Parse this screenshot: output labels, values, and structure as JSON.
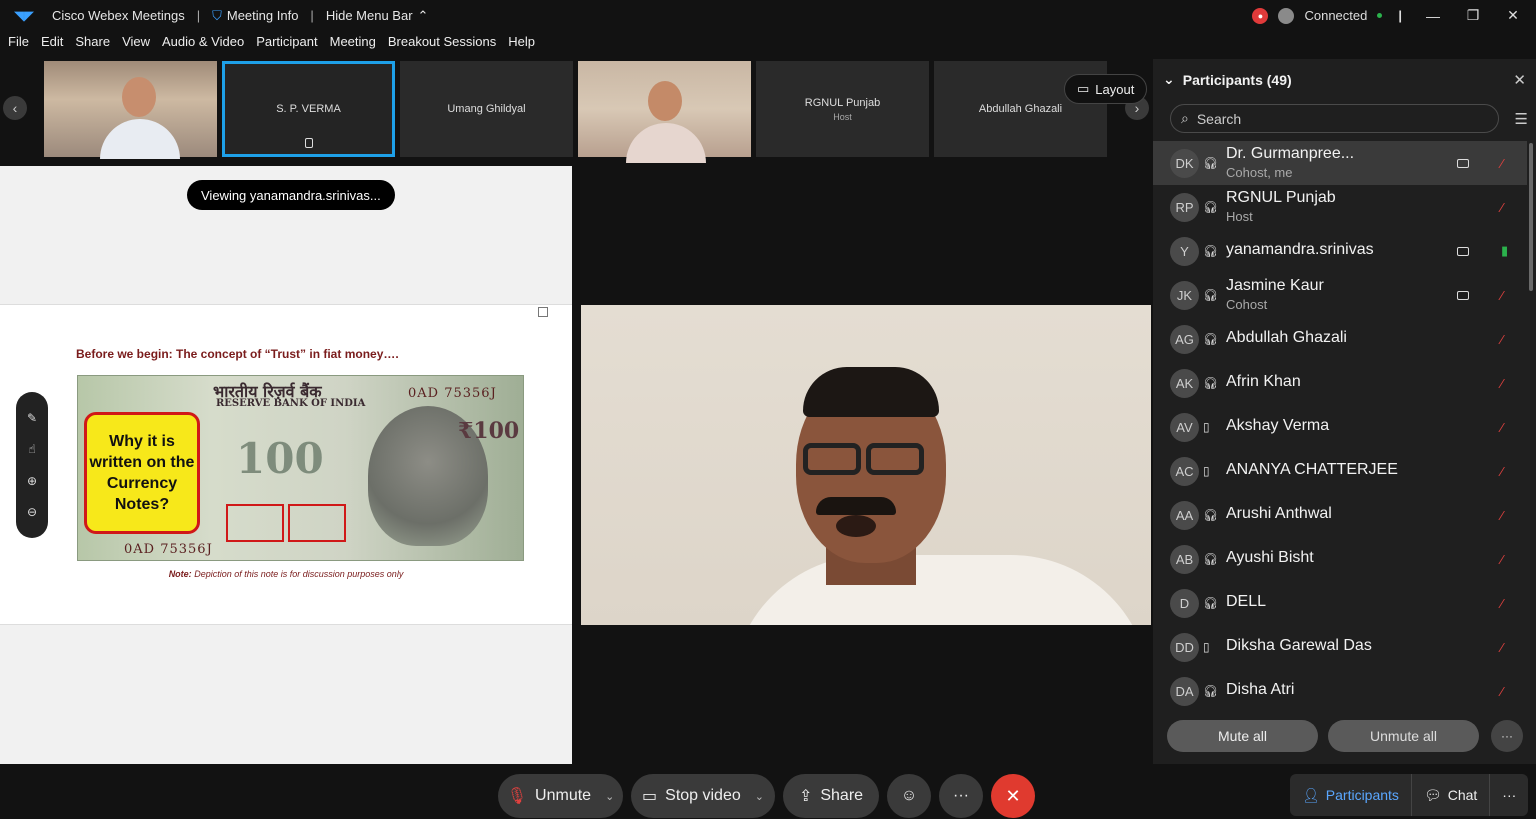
{
  "titlebar": {
    "app_name": "Cisco Webex Meetings",
    "meeting_info": "Meeting Info",
    "hide_menu": "Hide Menu Bar",
    "connection": "Connected"
  },
  "menu": [
    "File",
    "Edit",
    "Share",
    "View",
    "Audio & Video",
    "Participant",
    "Meeting",
    "Breakout Sessions",
    "Help"
  ],
  "filmstrip": {
    "tiles": [
      {
        "name": "",
        "type": "video"
      },
      {
        "name": "S. P. VERMA",
        "sub": ""
      },
      {
        "name": "Umang Ghildyal",
        "sub": ""
      },
      {
        "name": "",
        "type": "video"
      },
      {
        "name": "RGNUL Punjab",
        "sub": "Host"
      },
      {
        "name": "Abdullah Ghazali",
        "sub": ""
      }
    ],
    "layout_label": "Layout"
  },
  "share": {
    "viewing_label": "Viewing yanamandra.srinivas...",
    "slide_title": "Before we begin: The concept of “Trust” in fiat money….",
    "callout": "Why it is written on the Currency Notes?",
    "note_caption_bold": "Note:",
    "note_caption": "Depiction of this note is for discussion purposes only",
    "banknote": {
      "top_text": "भारतीय रिज़र्व बैंक",
      "bank": "RESERVE BANK OF INDIA",
      "serial": "0AD 75356J",
      "denomination": "₹100",
      "big": "100"
    }
  },
  "panel": {
    "title": "Participants (49)",
    "search_placeholder": "Search",
    "participants": [
      {
        "initials": "DK",
        "name": "Dr. Gurmanpree...",
        "role": "Cohost, me",
        "device": "headset",
        "video": true,
        "mic": "muted"
      },
      {
        "initials": "RP",
        "name": "RGNUL Punjab",
        "role": "Host",
        "device": "headset",
        "video": false,
        "mic": "muted"
      },
      {
        "initials": "Y",
        "name": "yanamandra.srinivas",
        "role": "",
        "device": "headset",
        "video": true,
        "mic": "on"
      },
      {
        "initials": "JK",
        "name": "Jasmine Kaur",
        "role": "Cohost",
        "device": "headset",
        "video": true,
        "mic": "muted"
      },
      {
        "initials": "AG",
        "name": "Abdullah Ghazali",
        "role": "",
        "device": "headset",
        "video": false,
        "mic": "muted"
      },
      {
        "initials": "AK",
        "name": "Afrin Khan",
        "role": "",
        "device": "headset",
        "video": false,
        "mic": "muted"
      },
      {
        "initials": "AV",
        "name": "Akshay Verma",
        "role": "",
        "device": "phone",
        "video": false,
        "mic": "muted"
      },
      {
        "initials": "AC",
        "name": "ANANYA CHATTERJEE",
        "role": "",
        "device": "phone",
        "video": false,
        "mic": "muted"
      },
      {
        "initials": "AA",
        "name": "Arushi Anthwal",
        "role": "",
        "device": "headset",
        "video": false,
        "mic": "muted"
      },
      {
        "initials": "AB",
        "name": "Ayushi Bisht",
        "role": "",
        "device": "headset",
        "video": false,
        "mic": "muted"
      },
      {
        "initials": "D",
        "name": "DELL",
        "role": "",
        "device": "headset",
        "video": false,
        "mic": "muted"
      },
      {
        "initials": "DD",
        "name": "Diksha Garewal Das",
        "role": "",
        "device": "phone",
        "video": false,
        "mic": "muted"
      },
      {
        "initials": "DA",
        "name": "Disha Atri",
        "role": "",
        "device": "headset",
        "video": false,
        "mic": "muted"
      }
    ],
    "mute_all": "Mute all",
    "unmute_all": "Unmute all"
  },
  "controls": {
    "unmute": "Unmute",
    "stop_video": "Stop video",
    "share": "Share",
    "participants_tab": "Participants",
    "chat_tab": "Chat"
  },
  "colors": {
    "accent": "#1ea0e8",
    "leave": "#e03a2f",
    "muted_red": "#e0413f",
    "active_green": "#2bb24c"
  }
}
